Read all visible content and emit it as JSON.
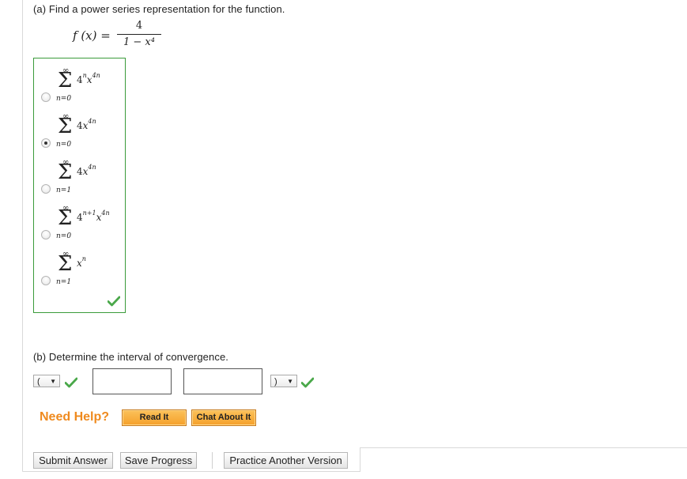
{
  "part_a": {
    "prompt": "(a) Find a power series representation for the function.",
    "function_lhs": "f (x) =",
    "numerator": "4",
    "denominator": "1 − x⁴",
    "choices": [
      {
        "upper": "∞",
        "lower": "n=0",
        "term_base": "4",
        "term_base_sup": "n",
        "term_var": "x",
        "term_var_sup": "4n",
        "selected": false
      },
      {
        "upper": "∞",
        "lower": "n=0",
        "term_base": "4",
        "term_base_sup": "",
        "term_var": "x",
        "term_var_sup": "4n",
        "selected": true
      },
      {
        "upper": "∞",
        "lower": "n=1",
        "term_base": "4",
        "term_base_sup": "",
        "term_var": "x",
        "term_var_sup": "4n",
        "selected": false
      },
      {
        "upper": "∞",
        "lower": "n=0",
        "term_base": "4",
        "term_base_sup": "n+1",
        "term_var": "x",
        "term_var_sup": "4n",
        "selected": false
      },
      {
        "upper": "∞",
        "lower": "n=1",
        "term_base": "",
        "term_base_sup": "",
        "term_var": "x",
        "term_var_sup": "n",
        "selected": false
      }
    ]
  },
  "part_b": {
    "prompt": "(b) Determine the interval of convergence.",
    "left_bracket": "(",
    "right_bracket": ")",
    "lower_value": "",
    "upper_value": ""
  },
  "help": {
    "label": "Need Help?",
    "read_it": "Read It",
    "chat_about_it": "Chat About It"
  },
  "actions": {
    "submit": "Submit Answer",
    "save": "Save Progress",
    "practice": "Practice Another Version"
  },
  "colors": {
    "correct_green": "#3a9b3a",
    "help_orange": "#ef8a1e"
  }
}
